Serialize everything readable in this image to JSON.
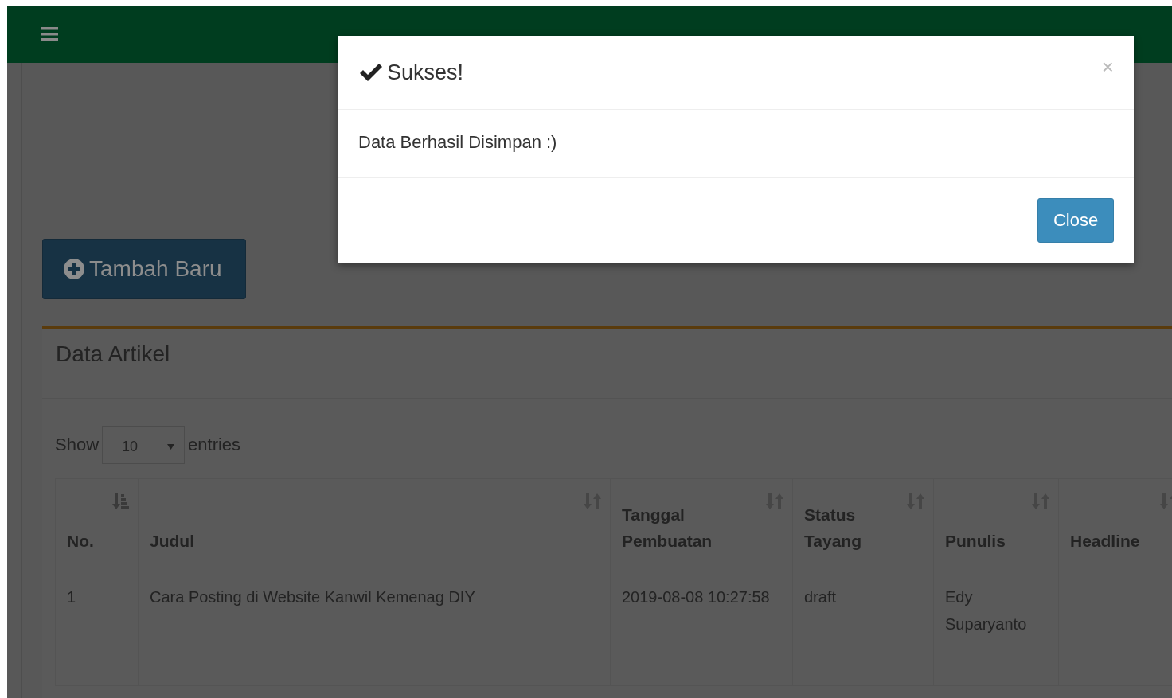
{
  "toolbar": {
    "add_button": "Tambah Baru"
  },
  "card": {
    "title": "Data Artikel",
    "length_menu": {
      "prefix": "Show",
      "value": "10",
      "suffix": "entries"
    }
  },
  "table": {
    "columns": [
      {
        "label": "No.",
        "sorted": true
      },
      {
        "label": "Judul",
        "sorted": false
      },
      {
        "label": "Tanggal Pembuatan",
        "sorted": false
      },
      {
        "label": "Status Tayang",
        "sorted": false
      },
      {
        "label": "Punulis",
        "sorted": false
      },
      {
        "label": "Headline",
        "sorted": false
      }
    ],
    "rows": [
      {
        "cells": [
          "1",
          "Cara Posting di Website Kanwil Kemenag DIY",
          "2019-08-08 10:27:58",
          "draft",
          "Edy Suparyanto",
          ""
        ]
      }
    ]
  },
  "modal": {
    "title": "Sukses!",
    "close_symbol": "×",
    "message": "Data Berhasil Disimpan :)",
    "button": "Close"
  }
}
